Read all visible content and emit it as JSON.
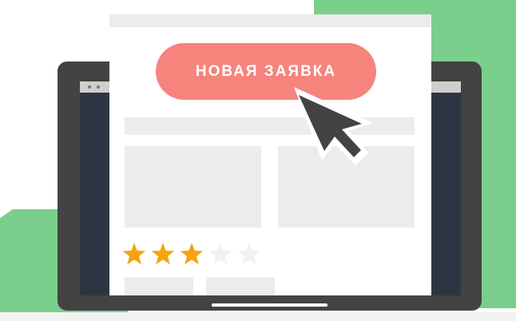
{
  "cta": {
    "label": "НОВАЯ ЗАЯВКА"
  },
  "rating": {
    "value": 3,
    "max": 5
  },
  "colors": {
    "accent": "#f6847d",
    "star_filled": "#f5a40f",
    "star_empty": "#f1f1f1",
    "green": "#7acf8c",
    "laptop_frame": "#434343",
    "screen": "#2c3642"
  },
  "icons": {
    "cursor": "arrow-cursor-icon",
    "star": "star-icon"
  }
}
